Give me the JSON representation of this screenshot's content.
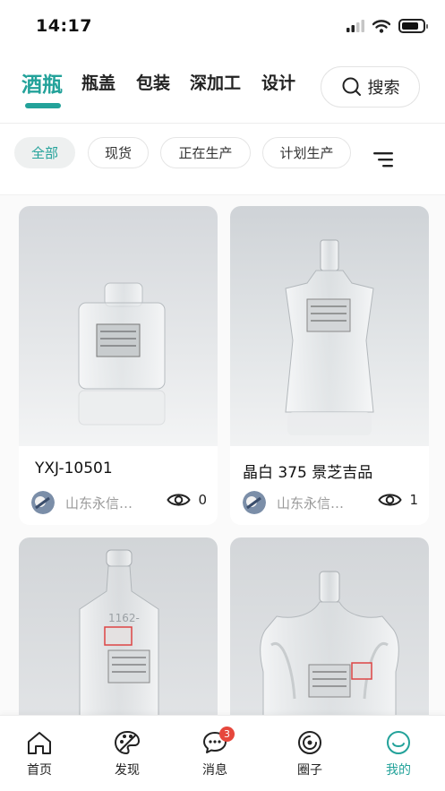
{
  "status_bar": {
    "time": "14:17",
    "icons": [
      "cellular-signal-icon",
      "wifi-icon",
      "battery-icon"
    ]
  },
  "category_tabs": [
    {
      "label": "酒瓶",
      "active": true
    },
    {
      "label": "瓶盖",
      "active": false
    },
    {
      "label": "包装",
      "active": false
    },
    {
      "label": "深加工",
      "active": false
    },
    {
      "label": "设计",
      "active": false
    }
  ],
  "search": {
    "label": "搜索",
    "icon": "search-icon"
  },
  "filters": [
    {
      "label": "全部",
      "active": true
    },
    {
      "label": "现货",
      "active": false
    },
    {
      "label": "正在生产",
      "active": false
    },
    {
      "label": "计划生产",
      "active": false
    }
  ],
  "sort_icon": "filter-lines-icon",
  "products": [
    {
      "title": "YXJ-10501",
      "author": "山东永信…",
      "views": "0"
    },
    {
      "title": "晶白 375 景芝吉品",
      "author": "山东永信…",
      "views": "1"
    },
    {
      "title": "",
      "author": "",
      "views": ""
    },
    {
      "title": "",
      "author": "",
      "views": ""
    }
  ],
  "bottom_nav": [
    {
      "label": "首页",
      "icon": "home-icon",
      "active": false
    },
    {
      "label": "发现",
      "icon": "palette-icon",
      "active": false
    },
    {
      "label": "消息",
      "icon": "chat-bubble-icon",
      "active": false,
      "badge": "3"
    },
    {
      "label": "圈子",
      "icon": "circle-swirl-icon",
      "active": false
    },
    {
      "label": "我的",
      "icon": "smiley-icon",
      "active": true
    }
  ],
  "colors": {
    "accent": "#23a29a",
    "badge": "#e6473c",
    "text": "#222222",
    "muted": "#9a9a9a"
  }
}
